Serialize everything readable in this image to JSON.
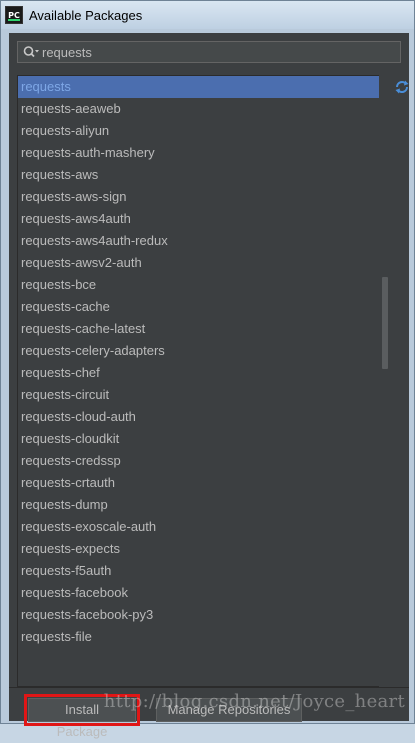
{
  "window": {
    "title": "Available Packages"
  },
  "search": {
    "value": "requests"
  },
  "packages": [
    "requests",
    "requests-aeaweb",
    "requests-aliyun",
    "requests-auth-mashery",
    "requests-aws",
    "requests-aws-sign",
    "requests-aws4auth",
    "requests-aws4auth-redux",
    "requests-awsv2-auth",
    "requests-bce",
    "requests-cache",
    "requests-cache-latest",
    "requests-celery-adapters",
    "requests-chef",
    "requests-circuit",
    "requests-cloud-auth",
    "requests-cloudkit",
    "requests-credssp",
    "requests-crtauth",
    "requests-dump",
    "requests-exoscale-auth",
    "requests-expects",
    "requests-f5auth",
    "requests-facebook",
    "requests-facebook-py3",
    "requests-file"
  ],
  "selected_index": 0,
  "buttons": {
    "install": "Install Package",
    "manage": "Manage Repositories"
  },
  "watermark": "http://blog.csdn.net/Joyce_heart",
  "colors": {
    "panel": "#3c3f41",
    "selection": "#4b6eaf",
    "highlight_box": "#e01616",
    "text": "#bbbbbb"
  }
}
